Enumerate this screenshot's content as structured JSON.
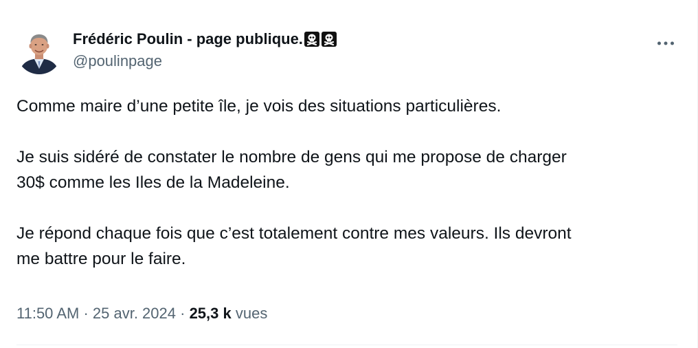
{
  "author": {
    "display_name": "Frédéric Poulin - page publique.",
    "emoji": [
      "skull-and-crossbones",
      "skull-and-crossbones"
    ],
    "handle": "@poulinpage"
  },
  "menu": {
    "icon": "more-horizontal-icon"
  },
  "tweet": {
    "paragraphs": [
      "Comme maire d’une petite île, je vois des situations particulières.",
      "Je suis sidéré de constater le nombre de gens qui me propose de charger\n30$ comme les Iles de la Madeleine.",
      "Je répond chaque fois que c’est totalement contre mes valeurs. Ils devront\nme battre pour le faire."
    ]
  },
  "meta": {
    "time": "11:50 AM",
    "separator": " · ",
    "date": "25 avr. 2024",
    "views_count": "25,3 k",
    "views_label": "vues"
  },
  "colors": {
    "text": "#0f1419",
    "secondary": "#536471",
    "divider": "#eff3f4"
  }
}
